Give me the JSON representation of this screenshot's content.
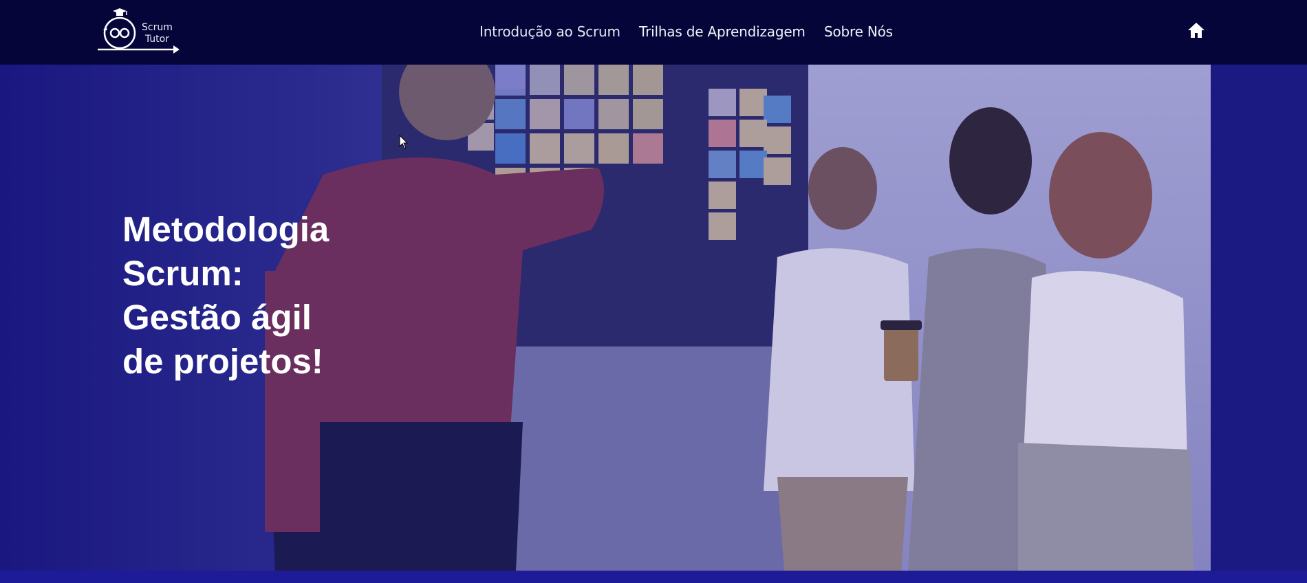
{
  "header": {
    "logo": {
      "name": "scrum-tutor-logo",
      "line1": "Scrum",
      "line2": "Tutor"
    },
    "nav": [
      {
        "label": "Introdução ao Scrum"
      },
      {
        "label": "Trilhas de Aprendizagem"
      },
      {
        "label": "Sobre Nós"
      }
    ],
    "home_icon": "home-icon"
  },
  "hero": {
    "title_lines": [
      "Metodologia",
      "Scrum:",
      "Gestão ágil",
      "de projetos!"
    ],
    "image": "team-at-scrum-board-photo"
  },
  "colors": {
    "header_bg": "#05053a",
    "hero_overlay": "#1b1a82",
    "text": "#ffffff"
  }
}
